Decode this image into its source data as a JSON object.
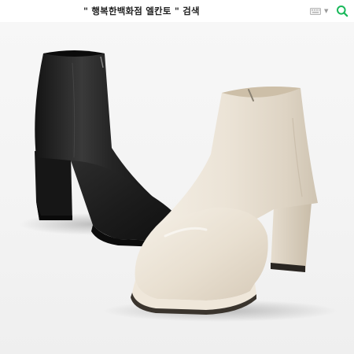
{
  "search": {
    "query": "\" 행복한백화점 엘칸토 \" 검색"
  },
  "colors": {
    "search_accent": "#19b85a",
    "boot_black": "#1b1b1b",
    "boot_ivory": "#ece4d7",
    "background": "#f5f5f5"
  },
  "icons": {
    "keyboard": "keyboard-icon",
    "dropdown": "caret-down-icon",
    "search": "search-icon"
  },
  "image": {
    "subject": "ankle-boots-pair",
    "variants": [
      "black",
      "ivory"
    ]
  }
}
